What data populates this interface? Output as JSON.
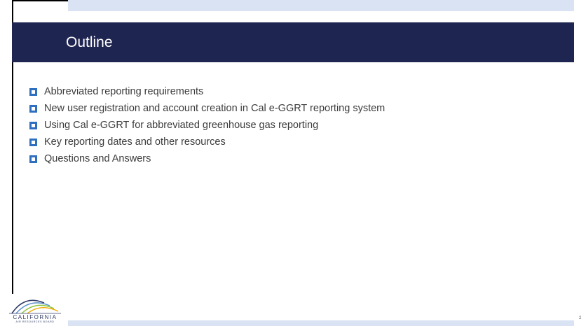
{
  "slide": {
    "title": "Outline",
    "bullets": [
      "Abbreviated reporting requirements",
      "New user registration and account creation in Cal e-GGRT reporting system",
      "Using Cal e-GGRT for abbreviated greenhouse gas reporting",
      "Key reporting dates and other resources",
      "Questions and Answers"
    ],
    "page_number": "2"
  },
  "logo": {
    "name": "CALIFORNIA",
    "subname": "AIR RESOURCES BOARD"
  },
  "colors": {
    "title_band": "#1f2551",
    "accent_bar": "#d9e3f3",
    "bullet": "#2f6fbf",
    "body_text": "#3b3b3b"
  }
}
